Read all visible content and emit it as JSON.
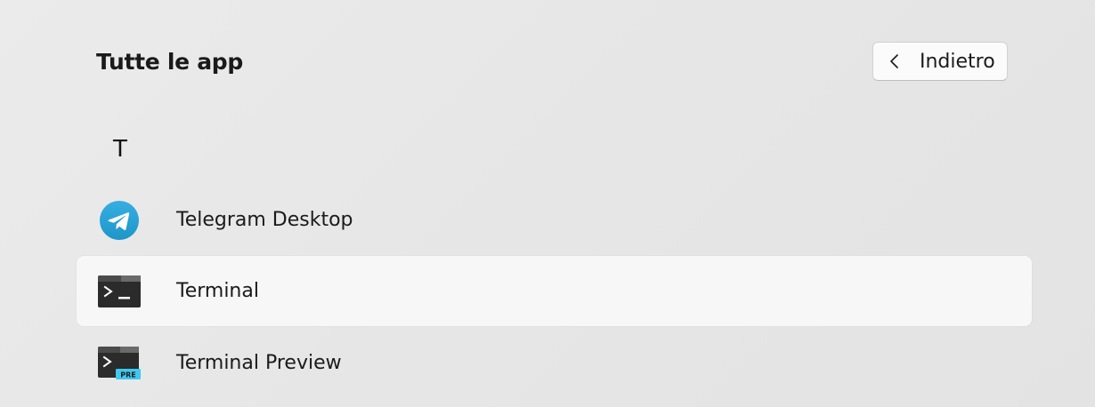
{
  "header": {
    "title": "Tutte le app",
    "back_label": "Indietro"
  },
  "groups": [
    {
      "letter": "T",
      "apps": [
        {
          "name": "Telegram Desktop",
          "icon": "telegram-icon"
        },
        {
          "name": "Terminal",
          "icon": "terminal-icon",
          "hovered": true
        },
        {
          "name": "Terminal Preview",
          "icon": "terminal-preview-icon",
          "badge": "PRE"
        }
      ]
    }
  ],
  "colors": {
    "background": "#e8e8e8",
    "hover_row": "#f7f7f7",
    "telegram_blue": "#2aa3e0",
    "terminal_dark": "#2b2b2b",
    "preview_badge": "#3fc8f0"
  }
}
